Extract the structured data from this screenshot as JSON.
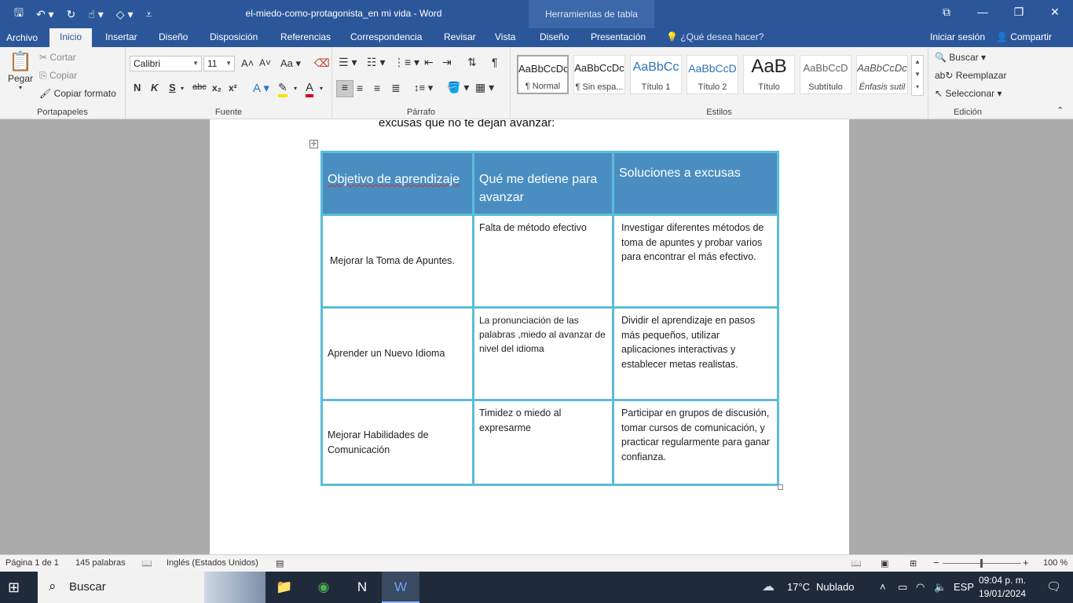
{
  "window": {
    "doc_title": "el-miedo-como-protagonista_en mi vida - Word",
    "context_tab_group": "Herramientas de tabla",
    "qat": {
      "save": "save-icon",
      "undo": "undo-icon",
      "redo": "redo-icon",
      "touch": "touch-icon",
      "customize": "customize-icon"
    }
  },
  "tabs": [
    "Archivo",
    "Inicio",
    "Insertar",
    "Diseño",
    "Disposición",
    "Referencias",
    "Correspondencia",
    "Revisar",
    "Vista",
    "Diseño",
    "Presentación"
  ],
  "tellme": "¿Qué desea hacer?",
  "signin": "Iniciar sesión",
  "share": "Compartir",
  "ribbon": {
    "clipboard": {
      "paste": "Pegar",
      "cut": "Cortar",
      "copy": "Copiar",
      "format_painter": "Copiar formato",
      "label": "Portapapeles"
    },
    "font": {
      "name": "Calibri",
      "size": "11",
      "label": "Fuente"
    },
    "paragraph": {
      "label": "Párrafo"
    },
    "styles": {
      "label": "Estilos",
      "items": [
        {
          "sample": "AaBbCcDc",
          "name": "¶ Normal"
        },
        {
          "sample": "AaBbCcDc",
          "name": "¶ Sin espa..."
        },
        {
          "sample": "AaBbCc",
          "name": "Título 1"
        },
        {
          "sample": "AaBbCcD",
          "name": "Título 2"
        },
        {
          "sample": "AaB",
          "name": "Título"
        },
        {
          "sample": "AaBbCcD",
          "name": "Subtítulo"
        },
        {
          "sample": "AaBbCcDc",
          "name": "Énfasis sutil"
        }
      ]
    },
    "editing": {
      "find": "Buscar",
      "replace": "Reemplazar",
      "select": "Seleccionar",
      "label": "Edición"
    }
  },
  "document": {
    "lead_line": "excusas que no te dejan avanzar:",
    "table": {
      "headers": [
        "Objetivo de aprendizaje",
        "Qué me detiene para avanzar",
        "Soluciones a excusas"
      ],
      "rows": [
        [
          "Mejorar la Toma de Apuntes.",
          "Falta de método efectivo",
          "Investigar diferentes métodos de toma de apuntes y probar varios para encontrar el más efectivo."
        ],
        [
          "Aprender un Nuevo Idioma",
          "La pronunciación de las palabras ,miedo al avanzar de nivel del idioma",
          "Dividir el aprendizaje en pasos más pequeños, utilizar aplicaciones interactivas y establecer metas realistas."
        ],
        [
          "Mejorar Habilidades de Comunicación",
          "Timidez o miedo al expresarme",
          "Participar en grupos de discusión, tomar cursos de comunicación, y practicar regularmente para ganar confianza."
        ]
      ]
    }
  },
  "status": {
    "page": "Página 1 de 1",
    "words": "145 palabras",
    "language": "Inglés (Estados Unidos)",
    "zoom": "100 %",
    "zoom_level": 1.0
  },
  "taskbar": {
    "search_placeholder": "Buscar",
    "weather_temp": "17°C",
    "weather_text": "Nublado",
    "lang": "ESP",
    "time": "09:04 p. m.",
    "date": "19/01/2024"
  }
}
